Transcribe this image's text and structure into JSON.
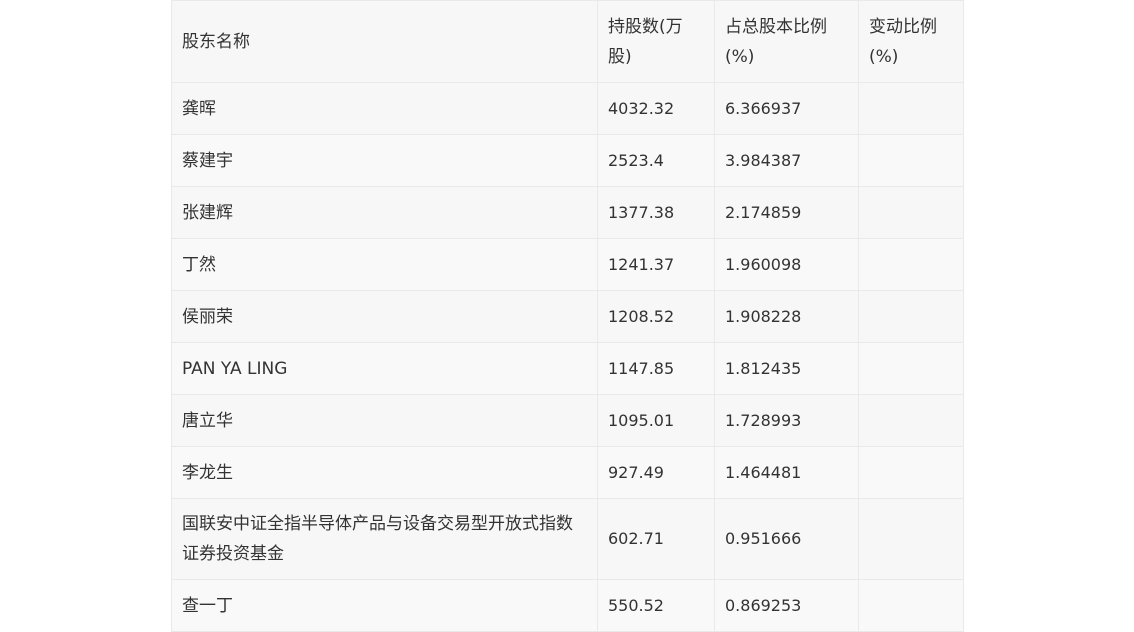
{
  "table": {
    "headers": [
      "股东名称",
      "持股数(万股)",
      "占总股本比例(%)",
      "变动比例(%)"
    ],
    "rows": [
      {
        "name": "龚晖",
        "shares": "4032.32",
        "ratio": "6.366937",
        "change": ""
      },
      {
        "name": "蔡建宇",
        "shares": "2523.4",
        "ratio": "3.984387",
        "change": ""
      },
      {
        "name": "张建辉",
        "shares": "1377.38",
        "ratio": "2.174859",
        "change": ""
      },
      {
        "name": "丁然",
        "shares": "1241.37",
        "ratio": "1.960098",
        "change": ""
      },
      {
        "name": "侯丽荣",
        "shares": "1208.52",
        "ratio": "1.908228",
        "change": ""
      },
      {
        "name": "PAN YA LING",
        "shares": "1147.85",
        "ratio": "1.812435",
        "change": ""
      },
      {
        "name": "唐立华",
        "shares": "1095.01",
        "ratio": "1.728993",
        "change": ""
      },
      {
        "name": "李龙生",
        "shares": "927.49",
        "ratio": "1.464481",
        "change": ""
      },
      {
        "name": "国联安中证全指半导体产品与设备交易型开放式指数证券投资基金",
        "shares": "602.71",
        "ratio": "0.951666",
        "change": ""
      },
      {
        "name": "查一丁",
        "shares": "550.52",
        "ratio": "0.869253",
        "change": ""
      }
    ]
  }
}
